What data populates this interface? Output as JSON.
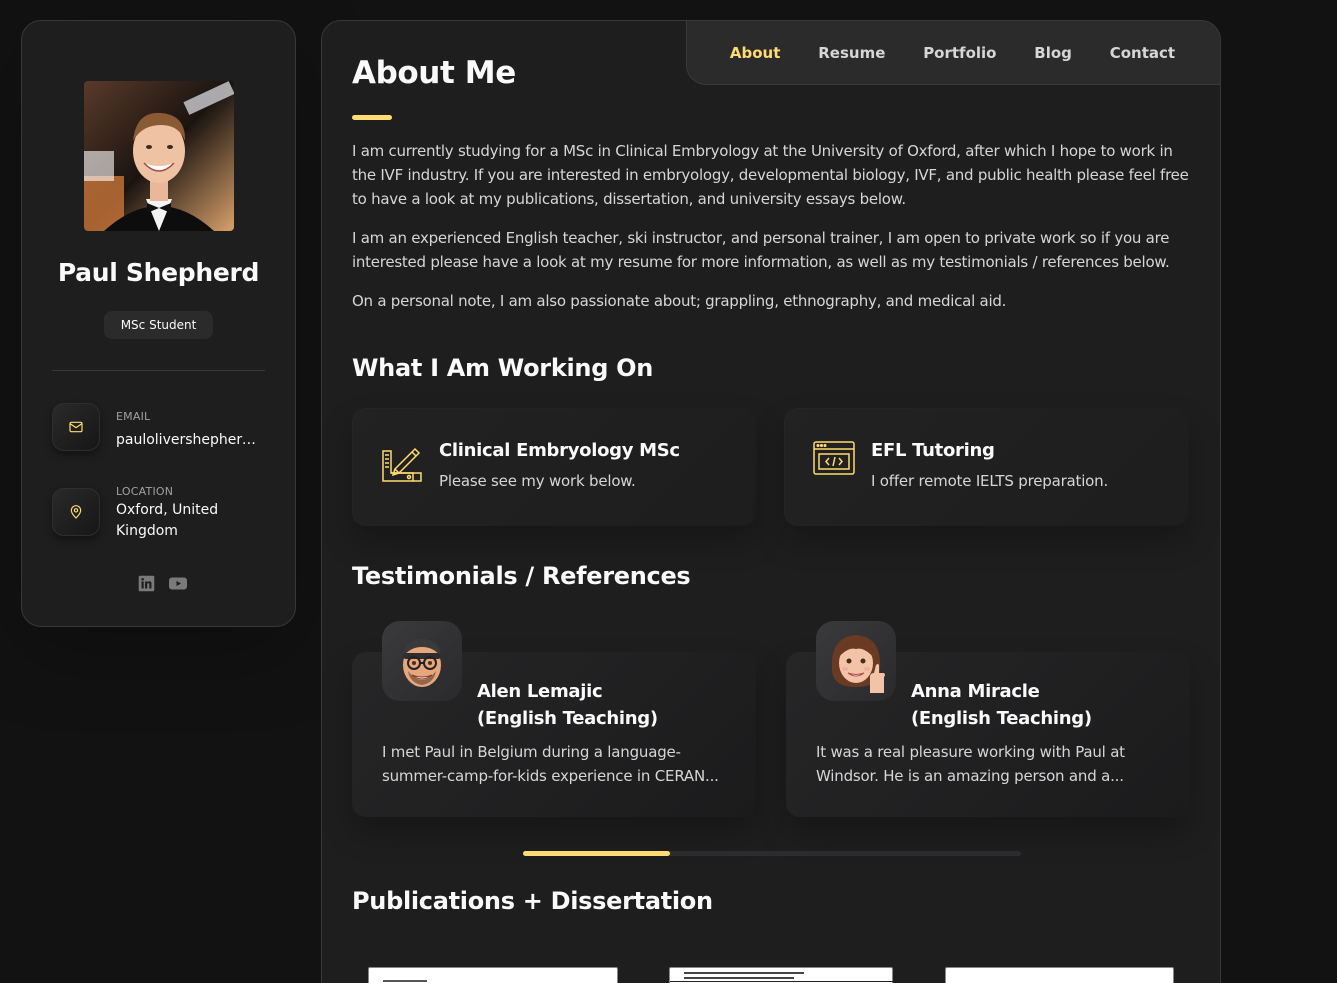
{
  "profile": {
    "name": "Paul Shepherd",
    "title": "MSc Student",
    "contacts": [
      {
        "label": "EMAIL",
        "value": "paulolivershepherd...",
        "icon": "mail-icon"
      },
      {
        "label": "LOCATION",
        "value": "Oxford, United Kingdom",
        "icon": "location-pin-icon"
      }
    ],
    "socials": [
      "linkedin-icon",
      "youtube-icon"
    ]
  },
  "nav": {
    "items": [
      "About",
      "Resume",
      "Portfolio",
      "Blog",
      "Contact"
    ],
    "active": "About"
  },
  "about": {
    "title": "About Me",
    "paragraphs": [
      "I am currently studying for a MSc in Clinical Embryology at the University of Oxford, after which I hope to work in the IVF industry. If you are interested in embryology, developmental biology, IVF, and public health please feel free to have a look at my publications, dissertation, and university essays below.",
      "I am an experienced English teacher, ski instructor, and personal trainer, I am open to private work so if you are interested please have a look at my resume for more information, as well as my testimonials / references below.",
      "On a personal note, I am also passionate about; grappling, ethnography, and medical aid."
    ]
  },
  "working_on": {
    "title": "What I Am Working On",
    "items": [
      {
        "title": "Clinical Embryology MSc",
        "desc": "Please see my work below.",
        "icon": "design-pen-icon"
      },
      {
        "title": "EFL Tutoring",
        "desc": "I offer remote IELTS preparation.",
        "icon": "code-window-icon"
      }
    ]
  },
  "testimonials": {
    "title": "Testimonials / References",
    "items": [
      {
        "name": "Alen Lemajic",
        "role": "(English Teaching)",
        "text": "I met Paul in Belgium during a language-summer-camp-for-kids experience in CERAN...",
        "avatar": "memoji-glasses-avatar"
      },
      {
        "name": "Anna Miracle",
        "role": "(English Teaching)",
        "text": "It was a real pleasure working with Paul at Windsor. He is an amazing person and a...",
        "avatar": "memoji-thumbsup-avatar"
      }
    ],
    "scroll_progress": 0.295
  },
  "publications": {
    "title": "Publications + Dissertation"
  },
  "colors": {
    "accent": "#ffdb70",
    "background": "#121212",
    "card": "#1e1e1f"
  }
}
